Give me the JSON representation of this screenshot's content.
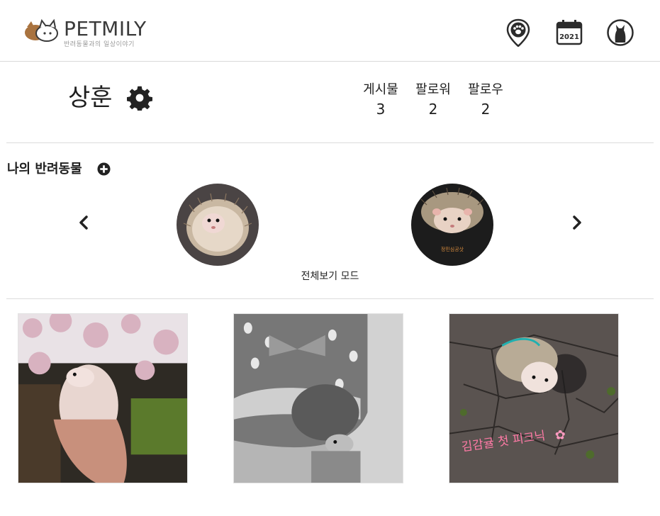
{
  "header": {
    "brand": "PETMILY",
    "tagline": "반려동물과의 일상이야기",
    "calendar_year": "2021",
    "icons": [
      "map-pin-paw-icon",
      "calendar-icon",
      "cat-profile-icon"
    ]
  },
  "profile": {
    "name": "상훈",
    "stats": [
      {
        "label": "게시물",
        "value": "3"
      },
      {
        "label": "팔로워",
        "value": "2"
      },
      {
        "label": "팔로우",
        "value": "2"
      }
    ]
  },
  "pets": {
    "title": "나의 반려동물",
    "pet2_caption": "정민심공삿",
    "view_all": "전체보기 모드"
  },
  "posts": {
    "post3_caption": "김감귤 첫 피크닉"
  },
  "colors": {
    "text": "#1e1e1e",
    "divider": "#dcdcdc",
    "logo_brown": "#a9733f"
  }
}
